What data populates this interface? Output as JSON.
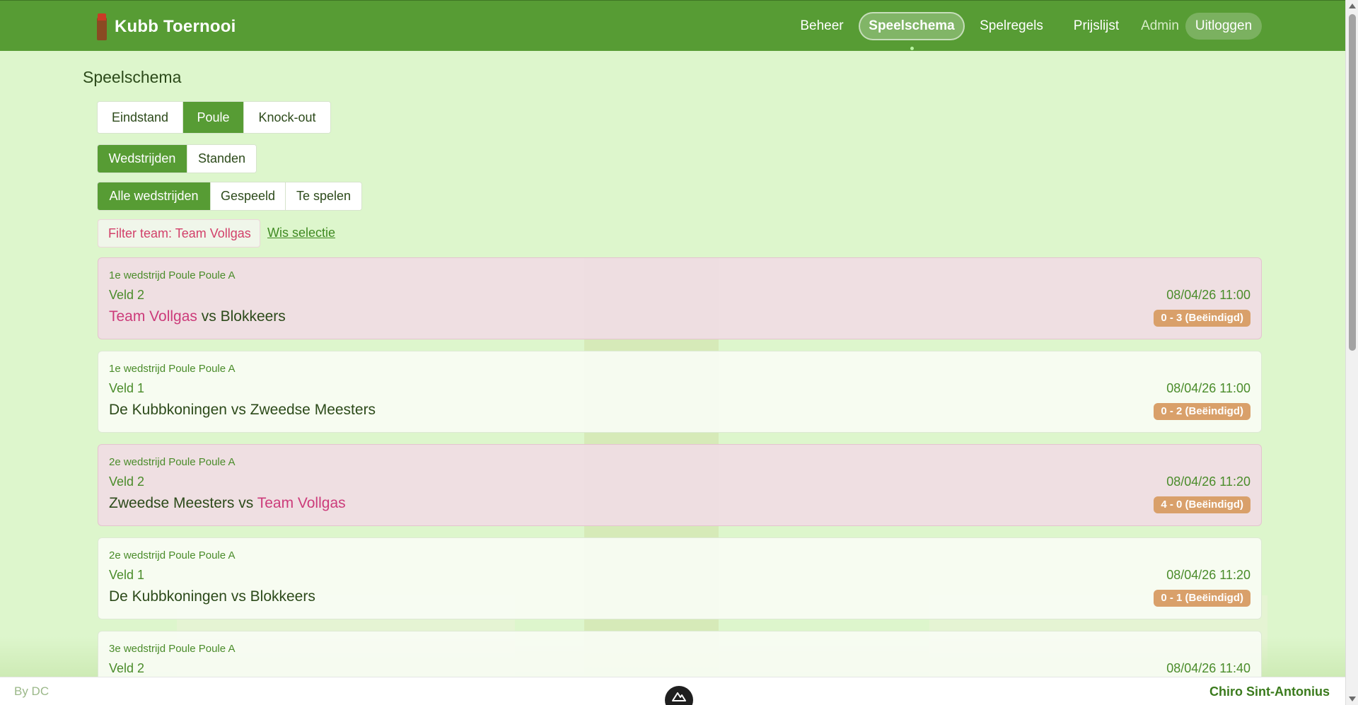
{
  "header": {
    "app_title": "Kubb Toernooi",
    "nav": {
      "beheer": "Beheer",
      "speelschema": "Speelschema",
      "spelregels": "Spelregels",
      "prijslijst": "Prijslijst",
      "admin": "Admin",
      "uitloggen": "Uitloggen"
    }
  },
  "page": {
    "title": "Speelschema",
    "view_tabs": [
      "Eindstand",
      "Poule",
      "Knock-out"
    ],
    "view_tabs_active": "Poule",
    "sub_tabs": [
      "Wedstrijden",
      "Standen"
    ],
    "sub_tabs_active": "Wedstrijden",
    "match_filters": [
      "Alle wedstrijden",
      "Gespeeld",
      "Te spelen"
    ],
    "match_filters_active": "Alle wedstrijden",
    "team_filter": "Filter team: Team Vollgas",
    "clear_selection": "Wis selectie"
  },
  "matches": [
    {
      "round": "1e wedstrijd Poule Poule A",
      "field": "Veld 2",
      "datetime": "08/04/26 11:00",
      "team1": "Team Vollgas",
      "vs": "vs",
      "team2": "Blokkeers",
      "score": "0 - 3 (Beëindigd)",
      "highlighted": true
    },
    {
      "round": "1e wedstrijd Poule Poule A",
      "field": "Veld 1",
      "datetime": "08/04/26 11:00",
      "team1": "De Kubbkoningen",
      "vs": "vs",
      "team2": "Zweedse Meesters",
      "score": "0 - 2 (Beëindigd)",
      "highlighted": false
    },
    {
      "round": "2e wedstrijd Poule Poule A",
      "field": "Veld 2",
      "datetime": "08/04/26 11:20",
      "team1": "Zweedse Meesters",
      "vs": "vs",
      "team2": "Team Vollgas",
      "score": "4 - 0 (Beëindigd)",
      "highlighted": true
    },
    {
      "round": "2e wedstrijd Poule Poule A",
      "field": "Veld 1",
      "datetime": "08/04/26 11:20",
      "team1": "De Kubbkoningen",
      "vs": "vs",
      "team2": "Blokkeers",
      "score": "0 - 1 (Beëindigd)",
      "highlighted": false
    },
    {
      "round": "3e wedstrijd Poule Poule A",
      "field": "Veld 2",
      "datetime": "08/04/26 11:40"
    }
  ],
  "footer": {
    "left": "By DC",
    "right": "Chiro Sint-Antonius"
  },
  "colors": {
    "brand_green": "#579c34",
    "page_bg": "#ddf6cc",
    "highlight_team": "#cc3b7a",
    "score_badge": "#d9a06a"
  },
  "icons": [
    "kubb-logo-icon",
    "devtools-icon"
  ]
}
